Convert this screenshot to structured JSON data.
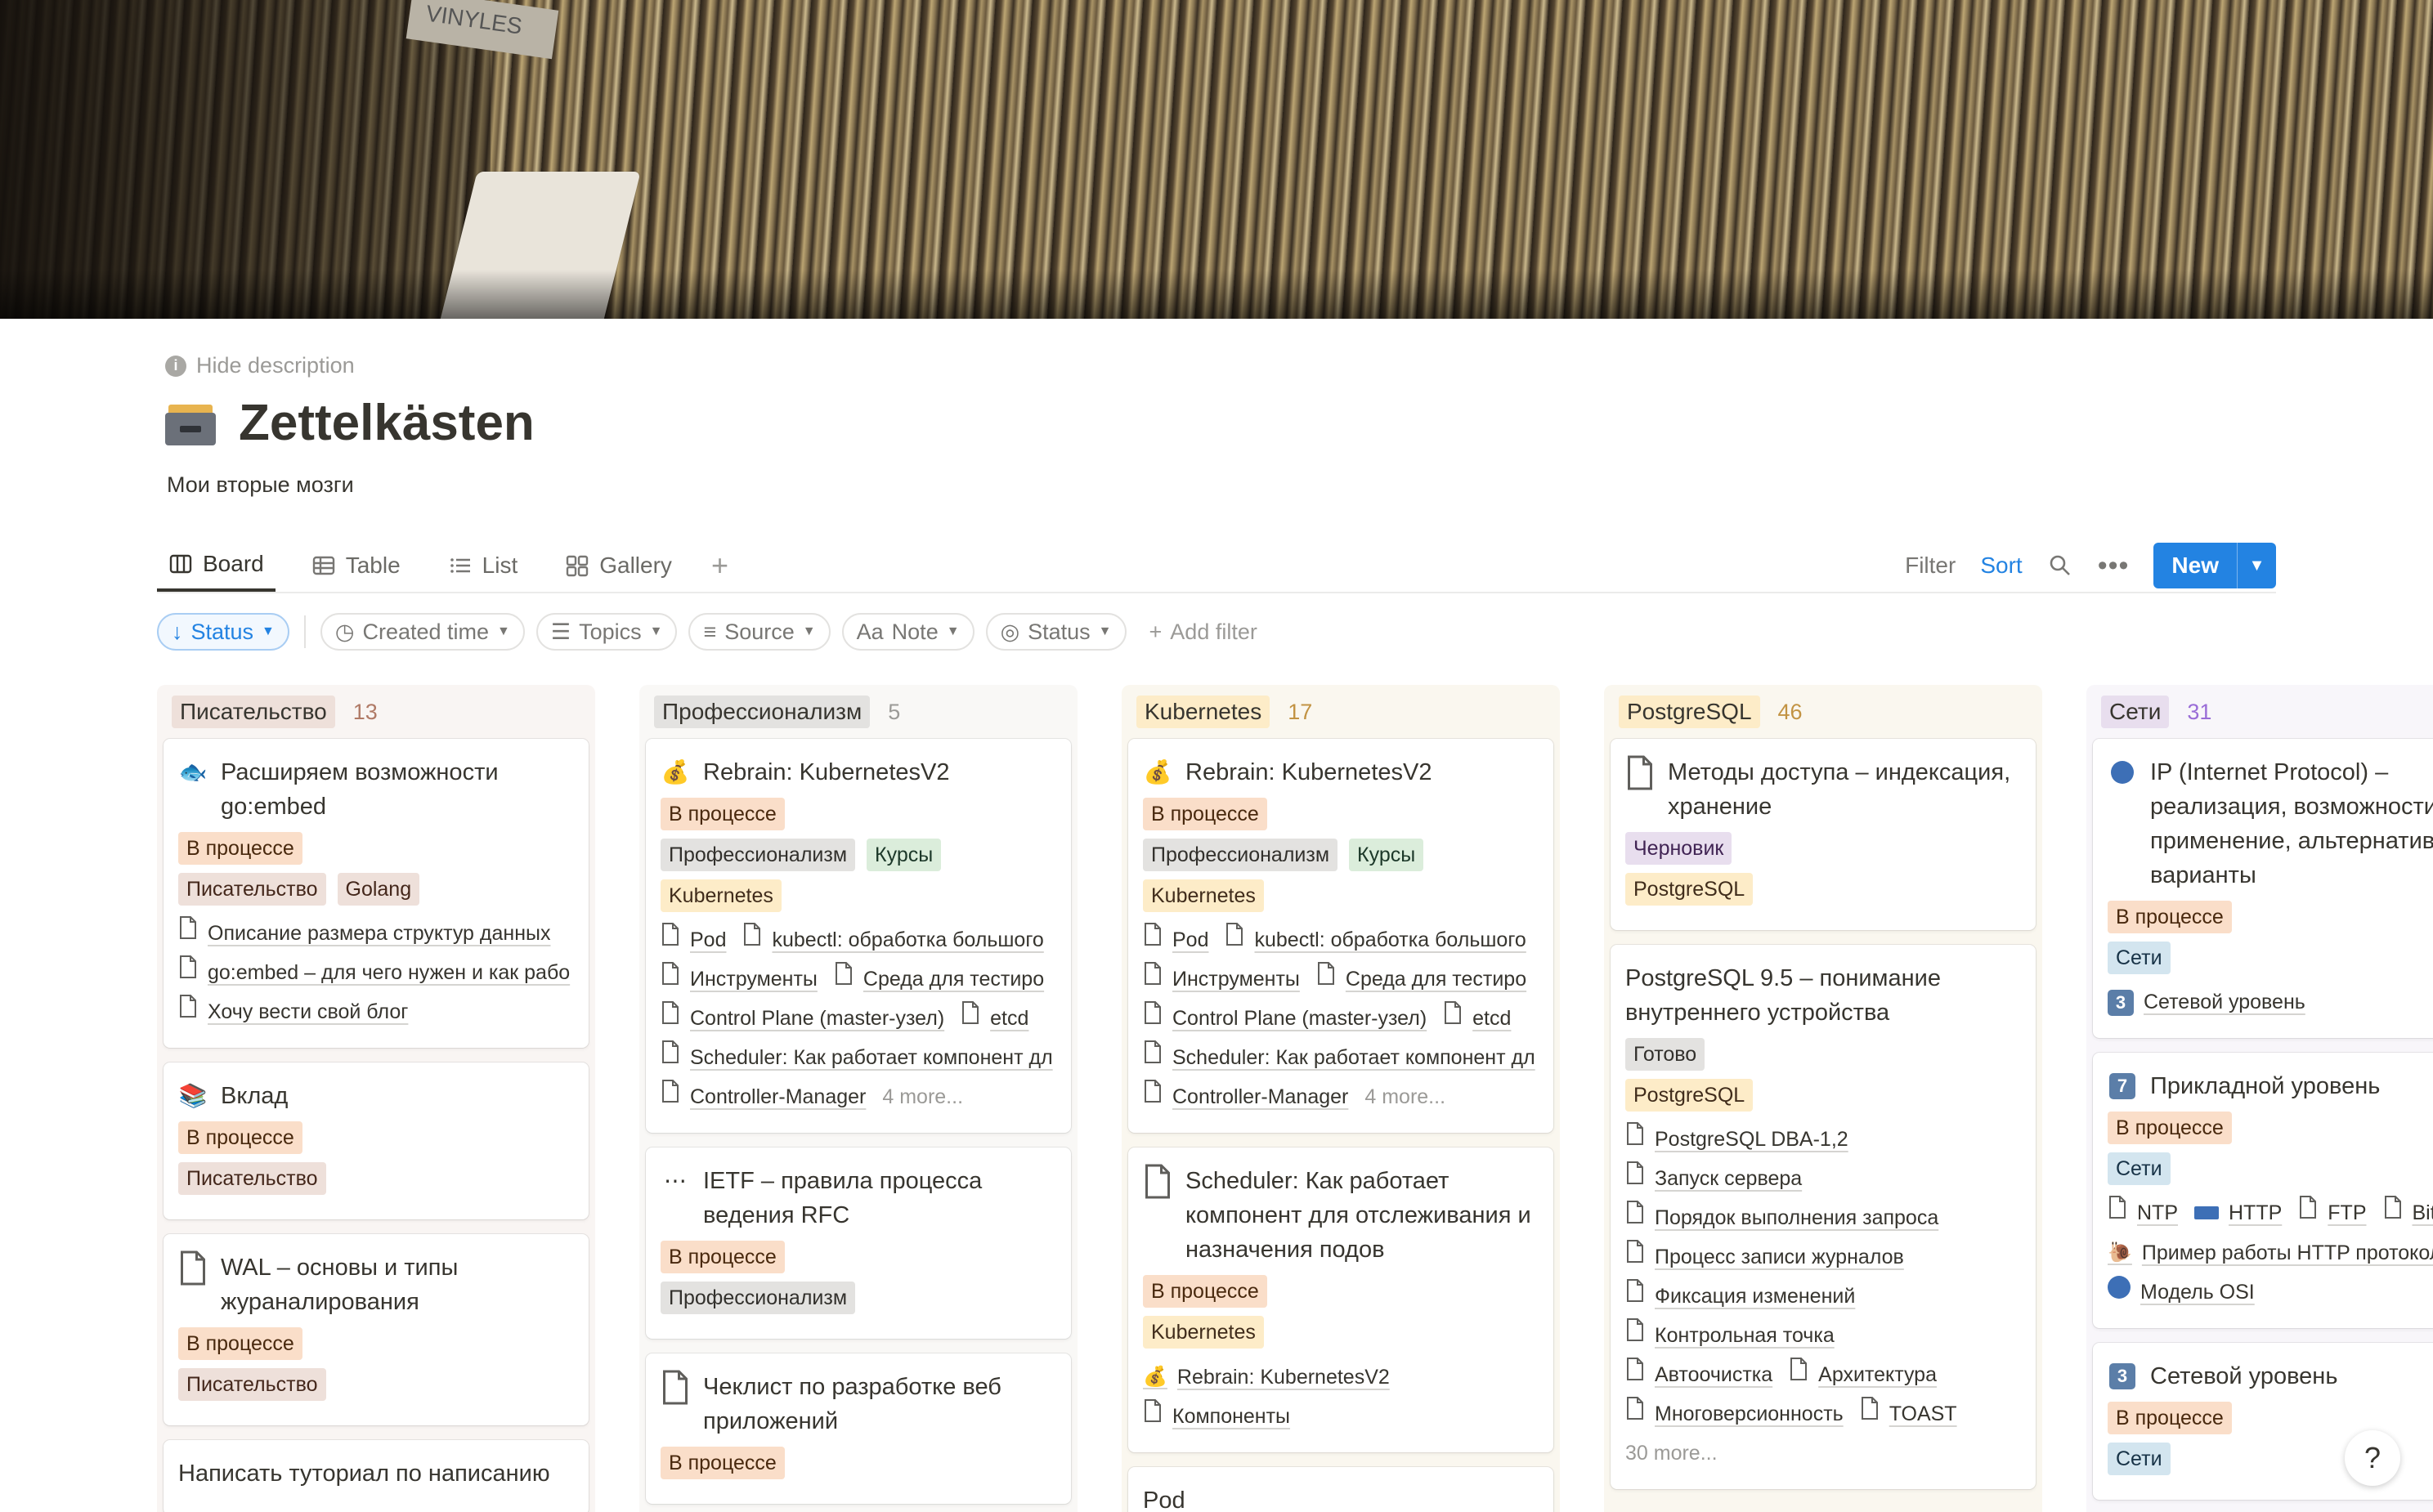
{
  "header": {
    "hide_description": "Hide description",
    "title": "Zettelkästen",
    "subtitle": "Мои вторые мозги"
  },
  "views": [
    {
      "label": "Board",
      "icon": "board-icon",
      "active": true
    },
    {
      "label": "Table",
      "icon": "table-icon"
    },
    {
      "label": "List",
      "icon": "list-icon"
    },
    {
      "label": "Gallery",
      "icon": "gallery-icon"
    }
  ],
  "toolbar": {
    "filter": "Filter",
    "sort": "Sort",
    "new": "New"
  },
  "filters": {
    "status_sort": "Status",
    "created_time": "Created time",
    "topics": "Topics",
    "source": "Source",
    "note": "Note",
    "status": "Status",
    "add_filter": "Add filter",
    "note_prefix": "Aa"
  },
  "colors": {
    "accent": "#2383e2"
  },
  "columns": [
    {
      "name": "Писательство",
      "count": "13",
      "bg": "#f9f5f3",
      "tag_bg": "#eee0da",
      "count_color": "#b07a66",
      "cards": [
        {
          "title": "Расширяем возможности go:embed",
          "icon": "fish-icon",
          "tags": [
            [
              "В процессе",
              "t-progress"
            ]
          ],
          "tags2": [
            [
              "Писательство",
              "t-brown"
            ],
            [
              "Golang",
              "t-brown"
            ]
          ],
          "rels": [
            [
              "Описание размера структур данных"
            ],
            [
              "go:embed – для чего нужен и как рабо"
            ],
            [
              "Хочу вести свой блог"
            ]
          ]
        },
        {
          "title": "Вклад",
          "icon": "books-icon",
          "tags": [
            [
              "В процессе",
              "t-progress"
            ]
          ],
          "tags2": [
            [
              "Писательство",
              "t-brown"
            ]
          ],
          "rels": []
        },
        {
          "title": "WAL – основы и типы жураналирования",
          "icon": "doc-icon",
          "tags": [
            [
              "В процессе",
              "t-progress"
            ]
          ],
          "tags2": [
            [
              "Писательство",
              "t-brown"
            ]
          ],
          "rels": []
        },
        {
          "title": "Написать туториал по написанию",
          "icon": "",
          "tags": [],
          "tags2": [],
          "rels": []
        }
      ]
    },
    {
      "name": "Профессионализм",
      "count": "5",
      "bg": "#f9f8f6",
      "tag_bg": "#e3e2e0",
      "count_color": "#9b9a97",
      "cards": [
        {
          "title": "Rebrain: KubernetesV2",
          "icon": "moneybag-icon",
          "tags": [
            [
              "В процессе",
              "t-progress"
            ]
          ],
          "tags2": [
            [
              "Профессионализм",
              "t-gray"
            ],
            [
              "Курсы",
              "t-green"
            ],
            [
              "Kubernetes",
              "t-yellow"
            ]
          ],
          "rels2": [
            [
              "Pod",
              "kubectl: обработка большого"
            ],
            [
              "Инструменты",
              "Среда для тестиро"
            ],
            [
              "Control Plane (master-узел)",
              "etcd"
            ],
            [
              "Scheduler: Как работает компонент дл"
            ],
            [
              "Controller-Manager"
            ]
          ],
          "more": "4 more..."
        },
        {
          "title": "IETF – правила процесса ведения RFC",
          "icon": "dots-icon",
          "tags": [
            [
              "В процессе",
              "t-progress"
            ]
          ],
          "tags2": [
            [
              "Профессионализм",
              "t-gray"
            ]
          ]
        },
        {
          "title": "Чеклист по разработке веб приложений",
          "icon": "doc-icon",
          "tags": [
            [
              "В процессе",
              "t-progress"
            ]
          ],
          "tags2": []
        }
      ]
    },
    {
      "name": "Kubernetes",
      "count": "17",
      "bg": "#faf7ef",
      "tag_bg": "#fdecc8",
      "count_color": "#c29343",
      "cards": [
        {
          "title": "Rebrain: KubernetesV2",
          "icon": "moneybag-icon",
          "tags": [
            [
              "В процессе",
              "t-progress"
            ]
          ],
          "tags2": [
            [
              "Профессионализм",
              "t-gray"
            ],
            [
              "Курсы",
              "t-green"
            ],
            [
              "Kubernetes",
              "t-yellow"
            ]
          ],
          "rels2": [
            [
              "Pod",
              "kubectl: обработка большого"
            ],
            [
              "Инструменты",
              "Среда для тестиро"
            ],
            [
              "Control Plane (master-узел)",
              "etcd"
            ],
            [
              "Scheduler: Как работает компонент дл"
            ],
            [
              "Controller-Manager"
            ]
          ],
          "more": "4 more..."
        },
        {
          "title": "Scheduler: Как работает компонент для отслеживания и назначения подов",
          "icon": "doc-icon",
          "tags": [
            [
              "В процессе",
              "t-progress"
            ]
          ],
          "tags2": [
            [
              "Kubernetes",
              "t-yellow"
            ]
          ],
          "rels3": [
            [
              "Rebrain: KubernetesV2",
              "moneybag"
            ],
            [
              "Компоненты",
              "doc"
            ]
          ]
        },
        {
          "title": "Pod",
          "icon": "",
          "tags": [],
          "tags2": []
        }
      ]
    },
    {
      "name": "PostgreSQL",
      "count": "46",
      "bg": "#faf7ef",
      "tag_bg": "#fdecc8",
      "count_color": "#c29343",
      "cards": [
        {
          "title": "Методы доступа – индексация, хранение",
          "icon": "doc-icon",
          "tags": [
            [
              "Черновик",
              "t-purple"
            ]
          ],
          "tags2": [
            [
              "PostgreSQL",
              "t-yellow"
            ]
          ]
        },
        {
          "title": "PostgreSQL 9.5 – понимание внутреннего устройства",
          "icon": "",
          "tags": [
            [
              "Готово",
              "t-gray"
            ]
          ],
          "tags2": [
            [
              "PostgreSQL",
              "t-yellow"
            ]
          ],
          "rels2": [
            [
              "PostgreSQL DBA-1,2"
            ],
            [
              "Запуск сервера"
            ],
            [
              "Порядок выполнения запроса"
            ],
            [
              "Процесс записи журналов"
            ],
            [
              "Фиксация изменений"
            ],
            [
              "Контрольная точка"
            ],
            [
              "Автоочистка",
              "Архитектура"
            ],
            [
              "Многоверсионность",
              "TOAST"
            ]
          ],
          "more": "30 more..."
        }
      ]
    },
    {
      "name": "Сети",
      "count": "31",
      "bg": "#f8f6fa",
      "tag_bg": "#e8deee",
      "count_color": "#9a6dd7",
      "cards": [
        {
          "title": "IP (Internet Protocol) – реализация, возможности, применение, альтернативные варианты",
          "icon": "globe-icon",
          "tags": [
            [
              "В процессе",
              "t-progress"
            ]
          ],
          "tags2": [
            [
              "Сети",
              "t-blue"
            ]
          ],
          "rels3": [
            [
              "Сетевой уровень",
              "3"
            ]
          ]
        },
        {
          "title": "Прикладной уровень",
          "icon": "num7-icon",
          "num": "7",
          "tags": [
            [
              "В процессе",
              "t-progress"
            ]
          ],
          "tags2": [
            [
              "Сети",
              "t-blue"
            ]
          ],
          "rels4": [
            [
              "NTP",
              "doc"
            ],
            [
              "HTTP",
              "flag"
            ],
            [
              "FTP",
              "doc"
            ],
            [
              "Bit torrent",
              "doc"
            ]
          ],
          "rels3": [
            [
              "Пример работы HTTP протокола с ме",
              "snail"
            ],
            [
              "Модель OSI",
              "globe"
            ]
          ]
        },
        {
          "title": "Сетевой уровень",
          "icon": "num3-icon",
          "num": "3",
          "tags": [
            [
              "В процессе",
              "t-progress"
            ]
          ],
          "tags2": [
            [
              "Сети",
              "t-blue"
            ]
          ]
        }
      ]
    }
  ],
  "help": "?"
}
